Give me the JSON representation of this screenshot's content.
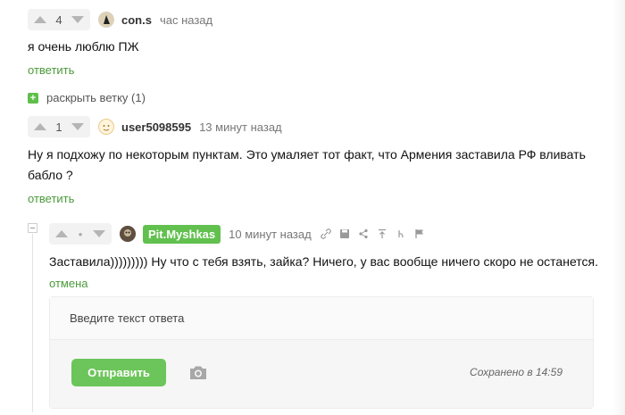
{
  "comments": [
    {
      "votes": "4",
      "username": "con.s",
      "time": "час назад",
      "text": "я очень люблю ПЖ",
      "reply_label": "ответить"
    },
    {
      "votes": "1",
      "username": "user5098595",
      "time": "13 минут назад",
      "text_line1": "Ну я подхожу по некоторым пунктам. Это умаляет тот факт, что Армения заставила РФ вливать",
      "text_line2": "бабло ?",
      "reply_label": "ответить"
    },
    {
      "votes": "•",
      "username": "Pit.Myshkas",
      "time": "10 минут назад",
      "text": "Заставила))))))))) Ну что с тебя взять, зайка? Ничего, у вас вообще ничего скоро не останется.",
      "cancel_label": "отмена"
    }
  ],
  "expand_thread": {
    "label": "раскрыть ветку (1)"
  },
  "reply_form": {
    "placeholder": "Введите текст ответа",
    "submit_label": "Отправить",
    "saved_status": "Сохранено в 14:59"
  },
  "colors": {
    "accent": "#62c14e",
    "link": "#4a9a3a"
  }
}
